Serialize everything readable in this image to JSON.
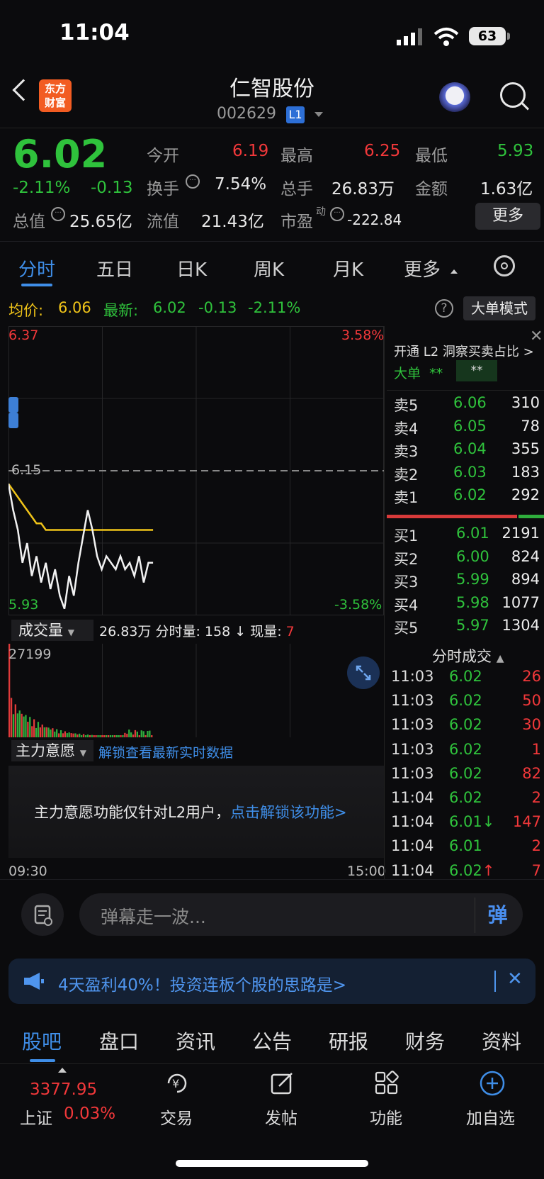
{
  "status_bar": {
    "time": "11:04",
    "battery": "63"
  },
  "header": {
    "logo_text_1": "东方",
    "logo_text_2": "财富",
    "title": "仁智股份",
    "code": "002629",
    "level_badge": "L1"
  },
  "quote": {
    "price": "6.02",
    "change_pct": "-2.11%",
    "change": "-0.13",
    "open_label": "今开",
    "open": "6.19",
    "high_label": "最高",
    "high": "6.25",
    "low_label": "最低",
    "low": "5.93",
    "turnover_label": "换手",
    "turnover": "7.54%",
    "volume_label": "总手",
    "volume": "26.83万",
    "amount_label": "金额",
    "amount": "1.63亿",
    "mktcap_label": "总值",
    "mktcap": "25.65亿",
    "float_label": "流值",
    "float_cap": "21.43亿",
    "pe_label": "市盈",
    "pe_sup": "动",
    "pe": "-222.84",
    "more_button": "更多"
  },
  "chart_tabs": [
    "分时",
    "五日",
    "日K",
    "周K",
    "月K",
    "更多"
  ],
  "legend": {
    "avg_label": "均价:",
    "avg": "6.06",
    "latest_label": "最新:",
    "latest": "6.02",
    "change": "-0.13",
    "change_pct": "-2.11%",
    "big_order_button": "大单模式"
  },
  "chart_data": {
    "type": "line",
    "y_max_label": "6.37",
    "y_min_label": "5.93",
    "pct_max_label": "3.58%",
    "pct_min_label": "-3.58%",
    "prev_close_label": "6.15",
    "x_start": "09:30",
    "x_end": "15:00",
    "ylim": [
      5.93,
      6.37
    ],
    "prev_close": 6.15,
    "series": [
      {
        "values": [
          6.13,
          6.09,
          6.06,
          6.01,
          6.04,
          5.99,
          6.02,
          5.98,
          6.01,
          5.97,
          6.0,
          5.96,
          5.94,
          5.99,
          5.96,
          6.01,
          6.05,
          6.09,
          6.06,
          6.02,
          6.0,
          6.02,
          6.01,
          6.0,
          6.02,
          6.0,
          6.01,
          5.99,
          6.02,
          5.98,
          6.01,
          6.01
        ]
      },
      {
        "values": [
          6.13,
          6.12,
          6.11,
          6.1,
          6.09,
          6.08,
          6.07,
          6.07,
          6.06,
          6.06,
          6.06,
          6.06,
          6.06,
          6.06,
          6.06,
          6.06,
          6.06,
          6.06,
          6.06,
          6.06,
          6.06,
          6.06,
          6.06,
          6.06,
          6.06,
          6.06,
          6.06,
          6.06,
          6.06,
          6.06,
          6.06,
          6.06
        ]
      }
    ],
    "volume_max_label": "27199"
  },
  "volume_panel": {
    "selector": "成交量",
    "total": "26.83万",
    "minute_label": "分时量:",
    "minute_value": "158",
    "arrow": "↓",
    "now_label": "现量:",
    "now_value": "7"
  },
  "main_force": {
    "selector": "主力意愿",
    "unlock_link": "解锁查看最新实时数据",
    "message": "主力意愿功能仅针对L2用户，",
    "message_link": "点击解锁该功能>"
  },
  "order_book": {
    "l2_prompt": "开通 L2 洞察买卖占比 >",
    "big_label": "大单",
    "big_v1": "**",
    "big_v2": "**",
    "asks": [
      {
        "label": "卖5",
        "price": "6.06",
        "vol": "310"
      },
      {
        "label": "卖4",
        "price": "6.05",
        "vol": "78"
      },
      {
        "label": "卖3",
        "price": "6.04",
        "vol": "355"
      },
      {
        "label": "卖2",
        "price": "6.03",
        "vol": "183"
      },
      {
        "label": "卖1",
        "price": "6.02",
        "vol": "292"
      }
    ],
    "bids": [
      {
        "label": "买1",
        "price": "6.01",
        "vol": "2191"
      },
      {
        "label": "买2",
        "price": "6.00",
        "vol": "824"
      },
      {
        "label": "买3",
        "price": "5.99",
        "vol": "894"
      },
      {
        "label": "买4",
        "price": "5.98",
        "vol": "1077"
      },
      {
        "label": "买5",
        "price": "5.97",
        "vol": "1304"
      }
    ],
    "trades_title": "分时成交",
    "trades": [
      {
        "time": "11:03",
        "price": "6.02",
        "vol": "26"
      },
      {
        "time": "11:03",
        "price": "6.02",
        "vol": "50"
      },
      {
        "time": "11:03",
        "price": "6.02",
        "vol": "30"
      },
      {
        "time": "11:03",
        "price": "6.02",
        "vol": "1"
      },
      {
        "time": "11:03",
        "price": "6.02",
        "vol": "82"
      },
      {
        "time": "11:04",
        "price": "6.02",
        "vol": "2"
      },
      {
        "time": "11:04",
        "price": "6.01↓",
        "vol": "147"
      },
      {
        "time": "11:04",
        "price": "6.01",
        "vol": "2"
      },
      {
        "time": "11:04",
        "price": "6.02↑",
        "vol": "7"
      }
    ]
  },
  "comment_bar": {
    "placeholder": "弹幕走一波...",
    "send": "弹"
  },
  "promo": {
    "text": "4天盈利40%！投资连板个股的思路是>"
  },
  "bottom_tabs": [
    "股吧",
    "盘口",
    "资讯",
    "公告",
    "研报",
    "财务",
    "资料"
  ],
  "nav": {
    "index_value": "3377.95",
    "index_name": "上证",
    "index_change": "0.03%",
    "trade": "交易",
    "post": "发帖",
    "functions": "功能",
    "add_watch": "加自选"
  },
  "colors": {
    "up": "#f2383a",
    "down": "#2fc23c",
    "accent": "#3f8ee8",
    "avg_line": "#f0c419"
  }
}
